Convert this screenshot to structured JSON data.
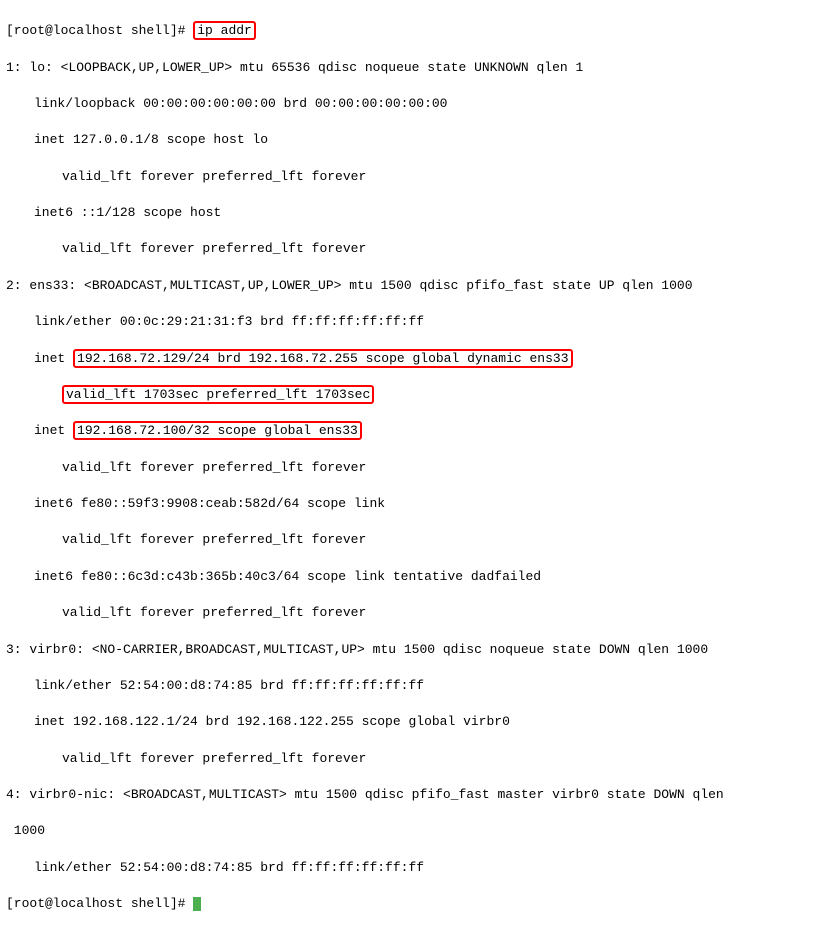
{
  "prompt1_user_host": "[root@localhost shell]# ",
  "command": "ip addr",
  "iface1_header": "1: lo: <LOOPBACK,UP,LOWER_UP> mtu 65536 qdisc noqueue state UNKNOWN qlen 1",
  "iface1_link": "link/loopback 00:00:00:00:00:00 brd 00:00:00:00:00:00",
  "iface1_inet": "inet 127.0.0.1/8 scope host lo",
  "iface1_valid1": "valid_lft forever preferred_lft forever",
  "iface1_inet6": "inet6 ::1/128 scope host",
  "iface1_valid2": "valid_lft forever preferred_lft forever",
  "iface2_header": "2: ens33: <BROADCAST,MULTICAST,UP,LOWER_UP> mtu 1500 qdisc pfifo_fast state UP qlen 1000",
  "iface2_link": "link/ether 00:0c:29:21:31:f3 brd ff:ff:ff:ff:ff:ff",
  "iface2_inet_pre": "inet ",
  "iface2_inet_box": "192.168.72.129/24 brd 192.168.72.255 scope global dynamic ens33",
  "iface2_valid1": "valid_lft 1703sec preferred_lft 1703sec",
  "iface2_inet2_pre": "inet ",
  "iface2_inet2_box": "192.168.72.100/32 scope global ens33",
  "iface2_valid2": "valid_lft forever preferred_lft forever",
  "iface2_inet6a": "inet6 fe80::59f3:9908:ceab:582d/64 scope link",
  "iface2_valid3": "valid_lft forever preferred_lft forever",
  "iface2_inet6b": "inet6 fe80::6c3d:c43b:365b:40c3/64 scope link tentative dadfailed",
  "iface2_valid4": "valid_lft forever preferred_lft forever",
  "iface3_header": "3: virbr0: <NO-CARRIER,BROADCAST,MULTICAST,UP> mtu 1500 qdisc noqueue state DOWN qlen 1000",
  "iface3_link": "link/ether 52:54:00:d8:74:85 brd ff:ff:ff:ff:ff:ff",
  "iface3_inet": "inet 192.168.122.1/24 brd 192.168.122.255 scope global virbr0",
  "iface3_valid1": "valid_lft forever preferred_lft forever",
  "iface4_header_pt1": "4: virbr0-nic: <BROADCAST,MULTICAST> mtu 1500 qdisc pfifo_fast master virbr0 state DOWN qlen",
  "iface4_header_pt2": " 1000",
  "iface4_link": "link/ether 52:54:00:d8:74:85 brd ff:ff:ff:ff:ff:ff",
  "prompt2": "[root@localhost shell]# "
}
